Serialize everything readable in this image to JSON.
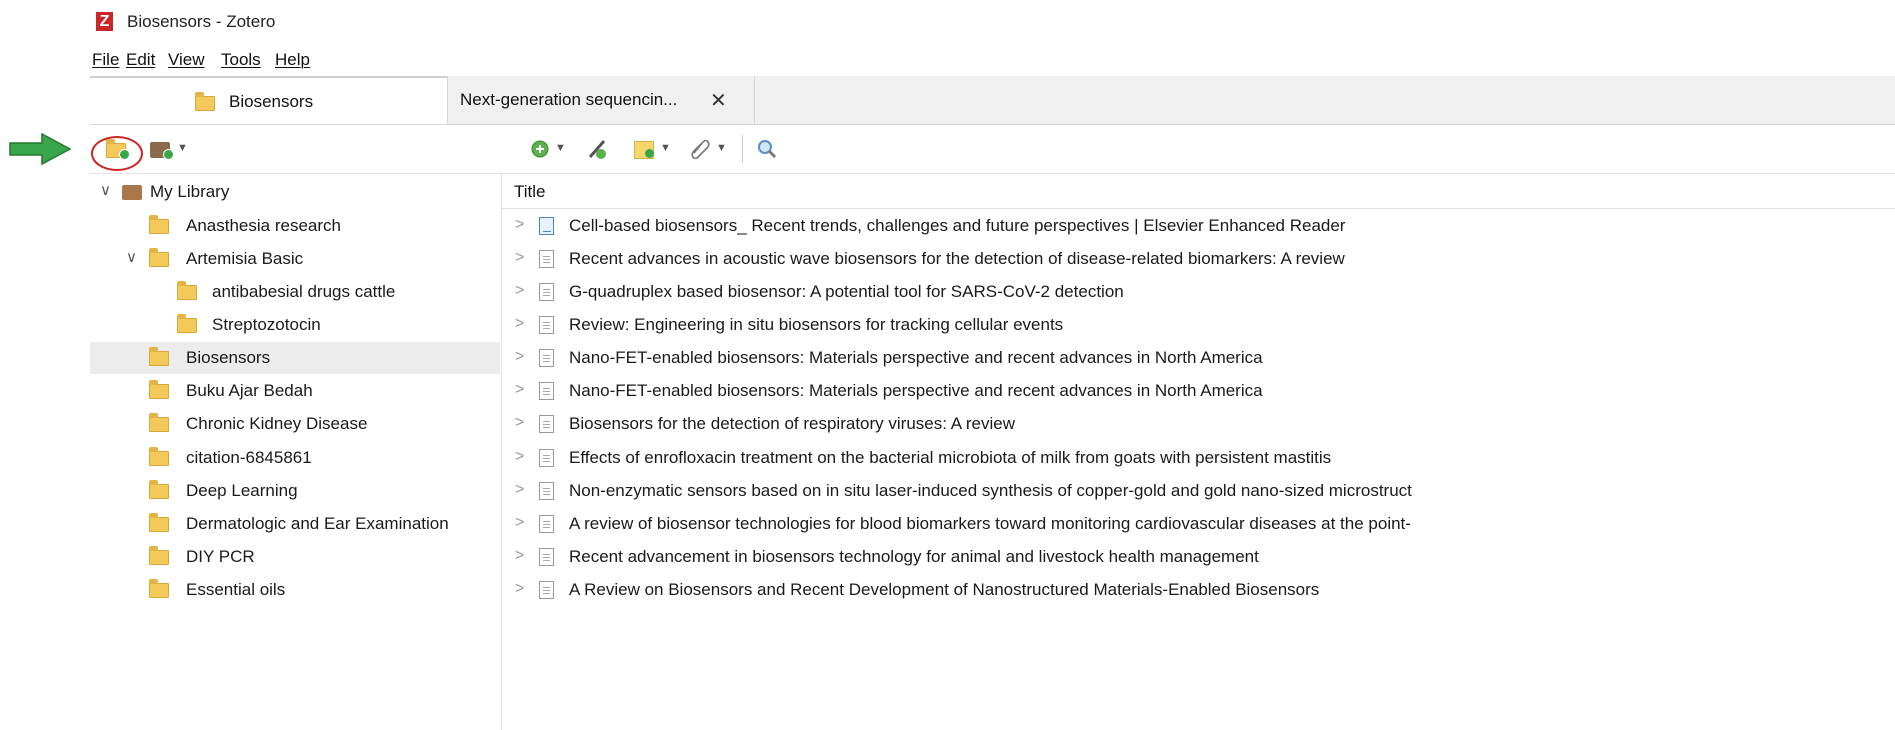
{
  "window": {
    "title": "Biosensors - Zotero",
    "accent": "#c8262b"
  },
  "menu": [
    "File",
    "Edit",
    "View",
    "Tools",
    "Help"
  ],
  "tabs": [
    {
      "label": "Biosensors",
      "icon": "folder-icon",
      "active": true
    },
    {
      "label": "Next-generation sequencin...",
      "close": "✕",
      "active": false
    }
  ],
  "toolbar": {
    "left": [
      "new-collection-icon",
      "new-library-icon"
    ],
    "right": [
      "new-item-icon",
      "add-by-identifier-icon",
      "new-note-icon",
      "add-attachment-icon",
      "search-icon"
    ]
  },
  "annotation": {
    "arrow_color": "#3aa64a",
    "ring_color": "#d02020"
  },
  "library": {
    "root": "My Library",
    "collections": [
      {
        "label": "Anasthesia research",
        "level": 1
      },
      {
        "label": "Artemisia Basic",
        "level": 1,
        "expanded": true
      },
      {
        "label": "antibabesial drugs cattle",
        "level": 2
      },
      {
        "label": "Streptozotocin",
        "level": 2
      },
      {
        "label": "Biosensors",
        "level": 1,
        "selected": true
      },
      {
        "label": "Buku Ajar Bedah",
        "level": 1
      },
      {
        "label": "Chronic Kidney Disease",
        "level": 1
      },
      {
        "label": "citation-6845861",
        "level": 1
      },
      {
        "label": "Deep Learning",
        "level": 1
      },
      {
        "label": "Dermatologic and Ear Examination",
        "level": 1
      },
      {
        "label": "DIY PCR",
        "level": 1
      },
      {
        "label": "Essential oils",
        "level": 1
      }
    ]
  },
  "items": {
    "column": "Title",
    "rows": [
      {
        "title": "Cell-based biosensors_ Recent trends, challenges and future perspectives | Elsevier Enhanced Reader",
        "type": "webpage"
      },
      {
        "title": "Recent advances in acoustic wave biosensors for the detection of disease-related biomarkers: A review",
        "type": "document"
      },
      {
        "title": "G-quadruplex based biosensor: A potential tool for SARS-CoV-2 detection",
        "type": "document"
      },
      {
        "title": "Review: Engineering in situ biosensors for tracking cellular events",
        "type": "document"
      },
      {
        "title": "Nano-FET-enabled biosensors: Materials perspective and recent advances in North America",
        "type": "document"
      },
      {
        "title": "Nano-FET-enabled biosensors: Materials perspective and recent advances in North America",
        "type": "document"
      },
      {
        "title": "Biosensors for the detection of respiratory viruses: A review",
        "type": "document"
      },
      {
        "title": "Effects of enrofloxacin treatment on the bacterial microbiota of milk from goats with persistent mastitis",
        "type": "document"
      },
      {
        "title": "Non-enzymatic sensors based on in situ laser-induced synthesis of copper-gold and gold nano-sized microstruct",
        "type": "document"
      },
      {
        "title": "A review of biosensor technologies for blood biomarkers toward monitoring cardiovascular diseases at the point-",
        "type": "document"
      },
      {
        "title": "Recent advancement in biosensors technology for animal and livestock health management",
        "type": "document"
      },
      {
        "title": "A Review on Biosensors and Recent Development of Nanostructured Materials-Enabled Biosensors",
        "type": "document"
      }
    ]
  }
}
